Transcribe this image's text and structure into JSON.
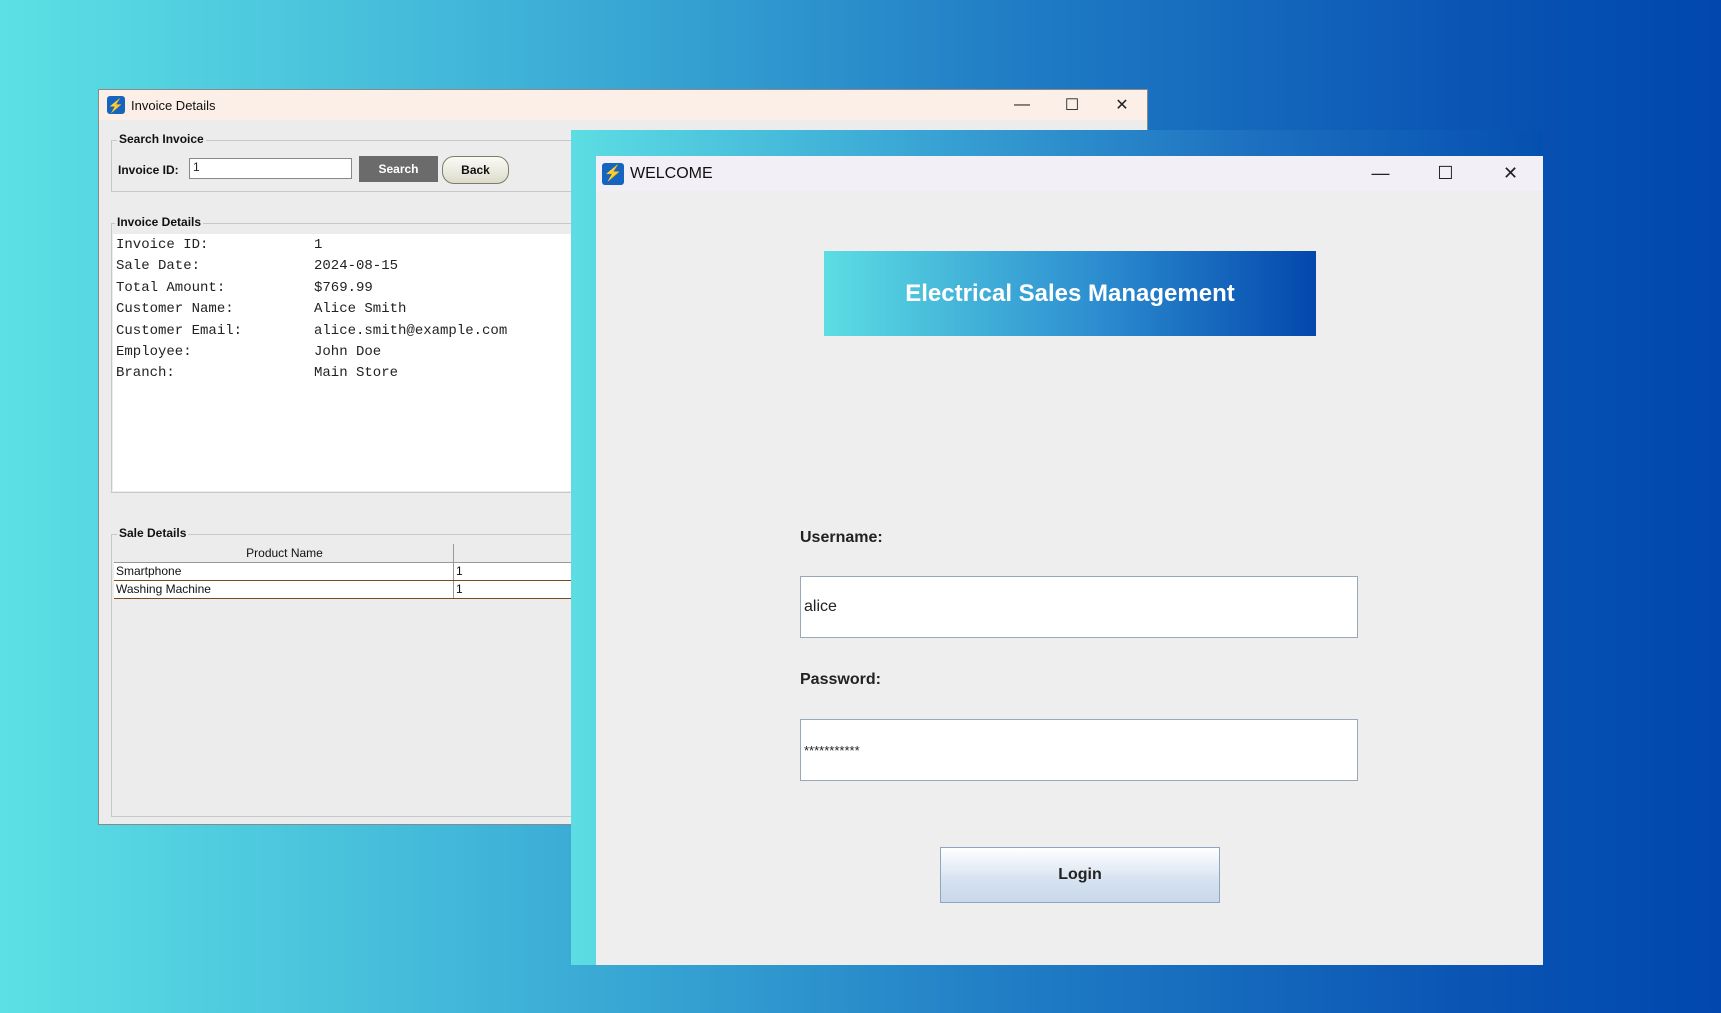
{
  "invoice_window": {
    "title": "Invoice Details",
    "search_group": {
      "legend": "Search Invoice",
      "invoice_id_label": "Invoice ID:",
      "invoice_id_value": "1",
      "search_label": "Search",
      "back_label": "Back"
    },
    "details_group": {
      "legend": "Invoice Details",
      "rows": [
        {
          "key": "Invoice ID:",
          "value": "1"
        },
        {
          "key": "Sale Date:",
          "value": "2024-08-15"
        },
        {
          "key": "Total Amount:",
          "value": "$769.99"
        },
        {
          "key": "Customer Name:",
          "value": "Alice Smith"
        },
        {
          "key": "Customer Email:",
          "value": "alice.smith@example.com"
        },
        {
          "key": "Employee:",
          "value": "John Doe"
        },
        {
          "key": "Branch:",
          "value": "Main Store"
        }
      ]
    },
    "sale_group": {
      "legend": "Sale Details",
      "columns": [
        "Product Name",
        ""
      ],
      "rows": [
        {
          "product": "Smartphone",
          "qty": "1"
        },
        {
          "product": "Washing Machine",
          "qty": "1"
        }
      ]
    }
  },
  "welcome_window": {
    "title": "WELCOME",
    "banner": "Electrical Sales Management",
    "username_label": "Username:",
    "username_value": "alice",
    "password_label": "Password:",
    "password_value": "***********",
    "login_label": "Login"
  },
  "window_controls": {
    "minimize": "—",
    "maximize": "☐",
    "close": "✕"
  },
  "icons": {
    "app": "lightning-icon"
  },
  "colors": {
    "banner_start": "#5cdde3",
    "banner_end": "#0347ad",
    "search_button": "#6b6b6b"
  }
}
